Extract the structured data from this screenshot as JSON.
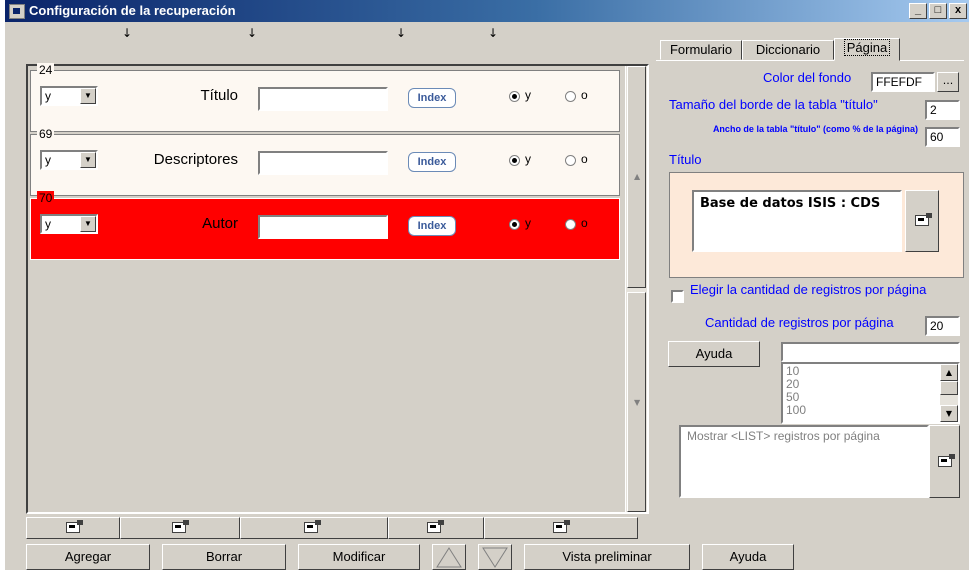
{
  "window": {
    "title": "Configuración de la recuperación",
    "controls": [
      "_",
      "□",
      "x"
    ]
  },
  "rows": [
    {
      "tag": "24",
      "operator": "y",
      "name": "Título",
      "index_label": "Index",
      "radio_y": "y",
      "radio_o": "o",
      "selected": "y",
      "highlight": false
    },
    {
      "tag": "69",
      "operator": "y",
      "name": "Descriptores",
      "index_label": "Index",
      "radio_y": "y",
      "radio_o": "o",
      "selected": "y",
      "highlight": true
    },
    {
      "tag": "70",
      "operator": "y",
      "name": "Autor",
      "index_label": "Index",
      "radio_y": "y",
      "radio_o": "o",
      "selected": "y",
      "highlight": true
    }
  ],
  "row_colors": {
    "normal": "#fdf8f2",
    "selected": "#ff0000"
  },
  "column_arrow_icon": "arrow-down-icon",
  "toolbar": {
    "agregar": "Agregar",
    "borrar": "Borrar",
    "modificar": "Modificar",
    "vista_preliminar": "Vista preliminar",
    "ayuda": "Ayuda"
  },
  "tabs": [
    "Formulario",
    "Diccionario",
    "Página"
  ],
  "active_tab": "Página",
  "page": {
    "color_label": "Color del fondo",
    "color_value": "FFEFDF",
    "color_button": "...",
    "border_label": "Tamaño del borde de la tabla \"título\"",
    "border_value": "2",
    "width_label": "Ancho de la tabla \"título\" (como % de la página)",
    "width_value": "60",
    "title_label": "Título",
    "title_text": "Base de datos ISIS : CDS",
    "title_box_color": "#fde9d9",
    "choose_label": "Elegir la cantidad de registros por página",
    "records_label": "Cantidad de registros por página",
    "records_value": "20",
    "help_button": "Ayuda",
    "list_options": [
      "10",
      "20",
      "50",
      "100"
    ],
    "list_template": "Mostrar <LIST> registros por página"
  }
}
